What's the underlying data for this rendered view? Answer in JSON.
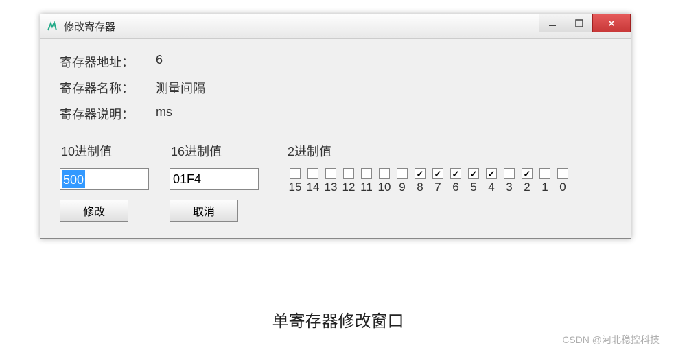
{
  "window": {
    "title": "修改寄存器"
  },
  "info": {
    "addr_label": "寄存器地址：",
    "addr_value": "6",
    "name_label": "寄存器名称：",
    "name_value": "测量间隔",
    "desc_label": "寄存器说明：",
    "desc_value": "ms"
  },
  "decimal": {
    "header": "10进制值",
    "value": "500",
    "button": "修改"
  },
  "hex": {
    "header": "16进制值",
    "value": "01F4",
    "button": "取消"
  },
  "binary": {
    "header": "2进制值",
    "bits": [
      {
        "label": "15",
        "checked": false
      },
      {
        "label": "14",
        "checked": false
      },
      {
        "label": "13",
        "checked": false
      },
      {
        "label": "12",
        "checked": false
      },
      {
        "label": "11",
        "checked": false
      },
      {
        "label": "10",
        "checked": false
      },
      {
        "label": "9",
        "checked": false
      },
      {
        "label": "8",
        "checked": true
      },
      {
        "label": "7",
        "checked": true
      },
      {
        "label": "6",
        "checked": true
      },
      {
        "label": "5",
        "checked": true
      },
      {
        "label": "4",
        "checked": true
      },
      {
        "label": "3",
        "checked": false
      },
      {
        "label": "2",
        "checked": true
      },
      {
        "label": "1",
        "checked": false
      },
      {
        "label": "0",
        "checked": false
      }
    ]
  },
  "caption": "单寄存器修改窗口",
  "watermark": "CSDN @河北稳控科技"
}
